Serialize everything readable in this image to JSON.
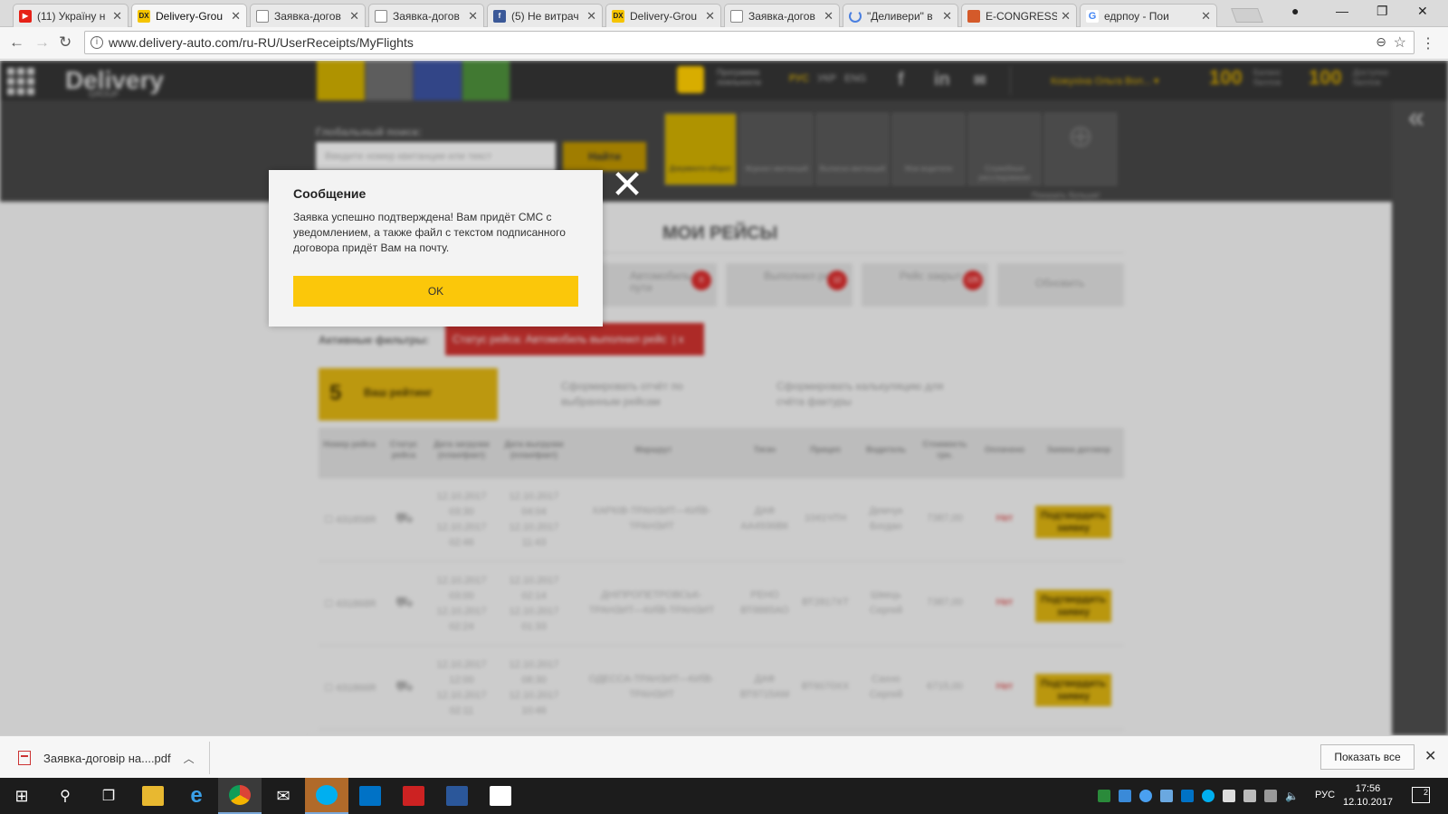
{
  "browser": {
    "tabs": [
      {
        "title": "(11) Україну н",
        "icon": "youtube-icon"
      },
      {
        "title": "Delivery-Grou",
        "icon": "delivery-icon",
        "active": true
      },
      {
        "title": "Заявка-догов",
        "icon": "document-icon"
      },
      {
        "title": "Заявка-догов",
        "icon": "document-icon"
      },
      {
        "title": "(5) Не витрач",
        "icon": "facebook-icon"
      },
      {
        "title": "Delivery-Grou",
        "icon": "delivery-icon"
      },
      {
        "title": "Заявка-догов",
        "icon": "document-icon"
      },
      {
        "title": "\"Деливери\" в",
        "icon": "loading-icon"
      },
      {
        "title": "E-CONGRESS",
        "icon": "econgress-icon"
      },
      {
        "title": "едрпоу - Пои",
        "icon": "google-icon"
      }
    ],
    "url": "www.delivery-auto.com/ru-RU/UserReceipts/MyFlights"
  },
  "site": {
    "logo": "Delivery",
    "logo_sub": "GROUP",
    "loyalty_label": "Программа лояльности",
    "langs": [
      "РУС",
      "УКР",
      "ENG"
    ],
    "user_name": "Кожухіна Ольга Вол...",
    "balance_1": {
      "value": "100",
      "label": "Баланс баллов"
    },
    "balance_2": {
      "value": "100",
      "label": "Доступно баллов"
    },
    "global_search_label": "Глобальный поиск:",
    "search_placeholder": "Введите номер квитанции или текст",
    "search_button": "Найти",
    "tiles": [
      "Документо-оборот",
      "Журнал квитанций",
      "Выписка квитанций",
      "Мои водители",
      "Служебные расследования"
    ],
    "show_more": "Показать больше!",
    "page_title": "МОИ РЕЙСЫ",
    "filters": [
      {
        "label": "Автомобиль в пути",
        "count": "0"
      },
      {
        "label": "Выполнил рейс",
        "count": "12"
      },
      {
        "label": "Рейс закрыт",
        "count": "125"
      },
      {
        "label": "Обновить",
        "count": ""
      }
    ],
    "active_filters_label": "Активные фильтры:",
    "active_filter_chip": "Статус рейса: Автомобиль выполнил рейс",
    "active_filter_remove": "x",
    "rating_value": "5",
    "rating_label": "Ваш рейтинг",
    "report_1": "Сформировать отчёт по выбранным рейсам",
    "report_2": "Сформировать калькуляцию для счёта фактуры",
    "table_headers": [
      "Номер рейса",
      "Статус рейса",
      "Дата загрузки (план/факт)",
      "Дата выгрузки (план/факт)",
      "Маршрут",
      "Тягач",
      "Прицеп",
      "Водитель",
      "Стоимость грн.",
      "Оплачено",
      "Заявка договор"
    ],
    "rows": [
      {
        "num": "431858R",
        "load_plan": "12.10.2017 03:30",
        "load_fact": "12.10.2017 02:46",
        "unload_plan": "12.10.2017 04:04",
        "unload_fact": "12.10.2017 11:43",
        "route": "ХАРКІВ-ТРАНЗИТ—КИЇВ-ТРАНЗИТ",
        "truck": "ДАФ АА4936ВК",
        "trailer": "1041ЧТН",
        "driver": "Демчук Богдан",
        "cost": "7387,00",
        "paid": "Нет",
        "action": "Подтвердить заявку"
      },
      {
        "num": "431868R",
        "load_plan": "12.10.2017 03:00",
        "load_fact": "12.10.2017 02:24",
        "unload_plan": "12.10.2017 02:14",
        "unload_fact": "12.10.2017 01:33",
        "route": "ДНІПРОПЕТРОВСЬК-ТРАНЗИТ—КИЇВ-ТРАНЗИТ",
        "truck": "РЕНО ВТ8885АО",
        "trailer": "ВТ2817ХТ",
        "driver": "Швець Сергей",
        "cost": "7387,00",
        "paid": "Нет",
        "action": "Подтвердить заявку"
      },
      {
        "num": "431866R",
        "load_plan": "12.10.2017 12:00",
        "load_fact": "12.10.2017 02:11",
        "unload_plan": "12.10.2017 08:30",
        "unload_fact": "12.10.2017 10:46",
        "route": "ОДЕССА-ТРАНЗИТ—КИЇВ-ТРАНЗИТ",
        "truck": "ДАФ ВТ9715АМ",
        "trailer": "ВТ6070ХХ",
        "driver": "Сахно Сергей",
        "cost": "6715,00",
        "paid": "Нет",
        "action": "Подтвердить заявку"
      }
    ]
  },
  "modal": {
    "title": "Сообщение",
    "body": "Заявка успешно подтверждена! Вам придёт СМС с уведомлением, а также файл с текстом подписанного договора придёт Вам на почту.",
    "ok": "OK",
    "close": "✕"
  },
  "downloads": {
    "file": "Заявка-договір на....pdf",
    "show_all": "Показать все"
  },
  "taskbar": {
    "lang": "РУС",
    "time": "17:56",
    "date": "12.10.2017",
    "notifications": "2"
  }
}
